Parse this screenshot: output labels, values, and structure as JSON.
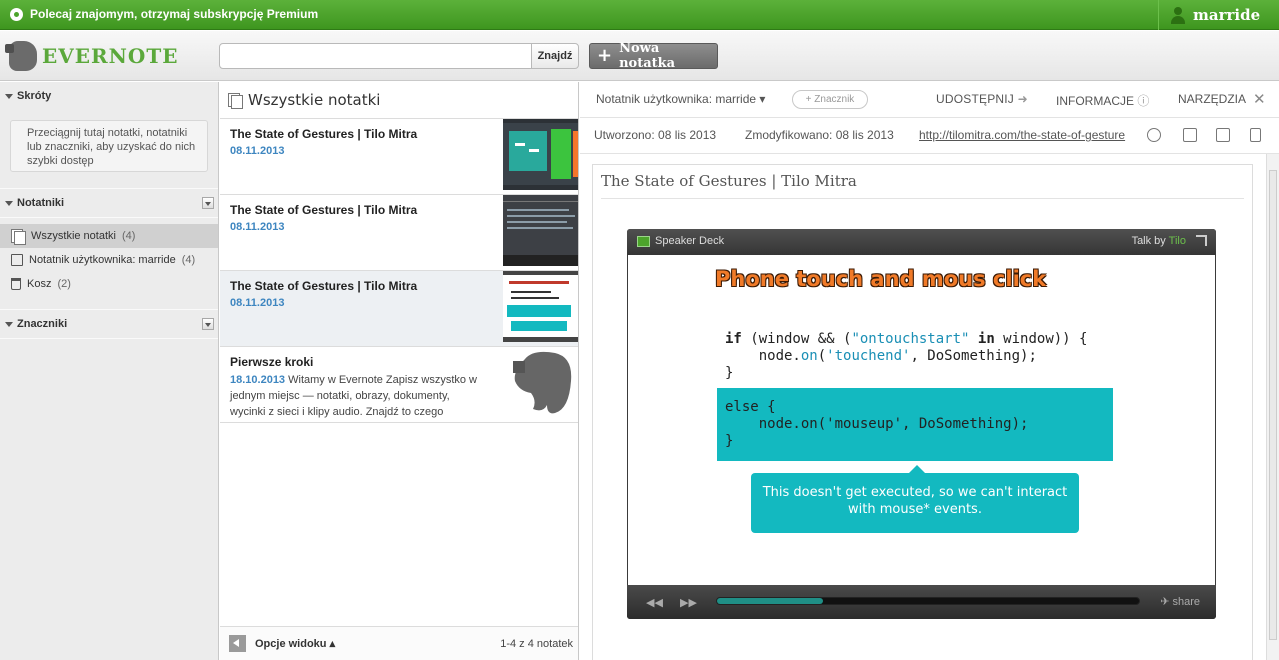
{
  "topbar": {
    "promo": "Polecaj znajomym, otrzymaj subskrypcję Premium",
    "username": "marride"
  },
  "header": {
    "logo": "EVERNOTE",
    "search_placeholder": "",
    "find_label": "Znajdź",
    "new_note_label": "Nowa notatka"
  },
  "sidebar": {
    "shortcuts_title": "Skróty",
    "shortcuts_hint": "Przeciągnij tutaj notatki, notatniki lub znaczniki, aby uzyskać do nich szybki dostęp",
    "notebooks_title": "Notatniki",
    "notebooks": [
      {
        "label": "Wszystkie notatki",
        "count": "(4)"
      },
      {
        "label": "Notatnik użytkownika: marride",
        "count": "(4)"
      },
      {
        "label": "Kosz",
        "count": "(2)"
      }
    ],
    "tags_title": "Znaczniki"
  },
  "list": {
    "title": "Wszystkie notatki",
    "notes": [
      {
        "title": "The State of Gestures | Tilo Mitra",
        "date": "08.11.2013",
        "snippet": ""
      },
      {
        "title": "The State of Gestures | Tilo Mitra",
        "date": "08.11.2013",
        "snippet": ""
      },
      {
        "title": "The State of Gestures | Tilo Mitra",
        "date": "08.11.2013",
        "snippet": ""
      },
      {
        "title": "Pierwsze kroki",
        "date": "18.10.2013",
        "snippet": "Witamy w Evernote Zapisz wszystko w jednym miejsc — notatki, obrazy, dokumenty, wycinki z sieci i klipy audio. Znajdź to czego"
      }
    ],
    "view_options": "Opcje widoku",
    "count_label": "1-4 z 4 notatek"
  },
  "editor": {
    "notebook": "Notatnik użytkownika: marride",
    "tag_button": "+ Znacznik",
    "share": "UDOSTĘPNIJ",
    "info": "INFORMACJE",
    "tools": "NARZĘDZIA",
    "created": "Utworzono: 08 lis 2013",
    "modified": "Zmodyfikowano: 08 lis 2013",
    "url": "http://tilomitra.com/the-state-of-gesture",
    "note_title": "The State of Gestures | Tilo Mitra"
  },
  "player": {
    "brand": "Speaker Deck",
    "talk_by": "Talk by",
    "author": "Tilo",
    "slide_title": "Phone touch and mous click",
    "bubble": "This doesn't get executed, so we can't interact with mouse* events.",
    "share": "share",
    "progress": 0.25
  },
  "colors": {
    "brand_green": "#4ca42b",
    "date_blue": "#3e86c0",
    "slide_cyan": "#13b9c0",
    "title_orange": "#f07a28"
  }
}
